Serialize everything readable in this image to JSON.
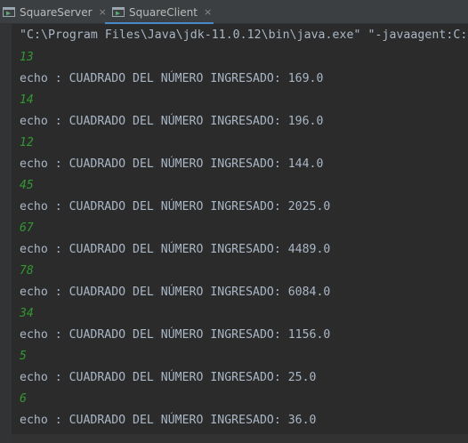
{
  "tabs": [
    {
      "label": "SquareServer",
      "close": "×",
      "active": false,
      "icon": "run-config-icon"
    },
    {
      "label": "SquareClient",
      "close": "×",
      "active": true,
      "icon": "run-config-icon"
    }
  ],
  "console": {
    "command": "\"C:\\Program Files\\Java\\jdk-11.0.12\\bin\\java.exe\" \"-javaagent:C:",
    "entries": [
      {
        "input": "13",
        "output": "echo : CUADRADO DEL NÚMERO INGRESADO: 169.0"
      },
      {
        "input": "14",
        "output": "echo : CUADRADO DEL NÚMERO INGRESADO: 196.0"
      },
      {
        "input": "12",
        "output": "echo : CUADRADO DEL NÚMERO INGRESADO: 144.0"
      },
      {
        "input": "45",
        "output": "echo : CUADRADO DEL NÚMERO INGRESADO: 2025.0"
      },
      {
        "input": "67",
        "output": "echo : CUADRADO DEL NÚMERO INGRESADO: 4489.0"
      },
      {
        "input": "78",
        "output": "echo : CUADRADO DEL NÚMERO INGRESADO: 6084.0"
      },
      {
        "input": "34",
        "output": "echo : CUADRADO DEL NÚMERO INGRESADO: 1156.0"
      },
      {
        "input": "5",
        "output": "echo : CUADRADO DEL NÚMERO INGRESADO: 25.0"
      },
      {
        "input": "6",
        "output": "echo : CUADRADO DEL NÚMERO INGRESADO: 36.0"
      }
    ]
  },
  "colors": {
    "background": "#2b2b2b",
    "tabbar": "#3c3f41",
    "text": "#a9b7c6",
    "input_text": "#339933",
    "active_tab_underline": "#4a88c7"
  }
}
